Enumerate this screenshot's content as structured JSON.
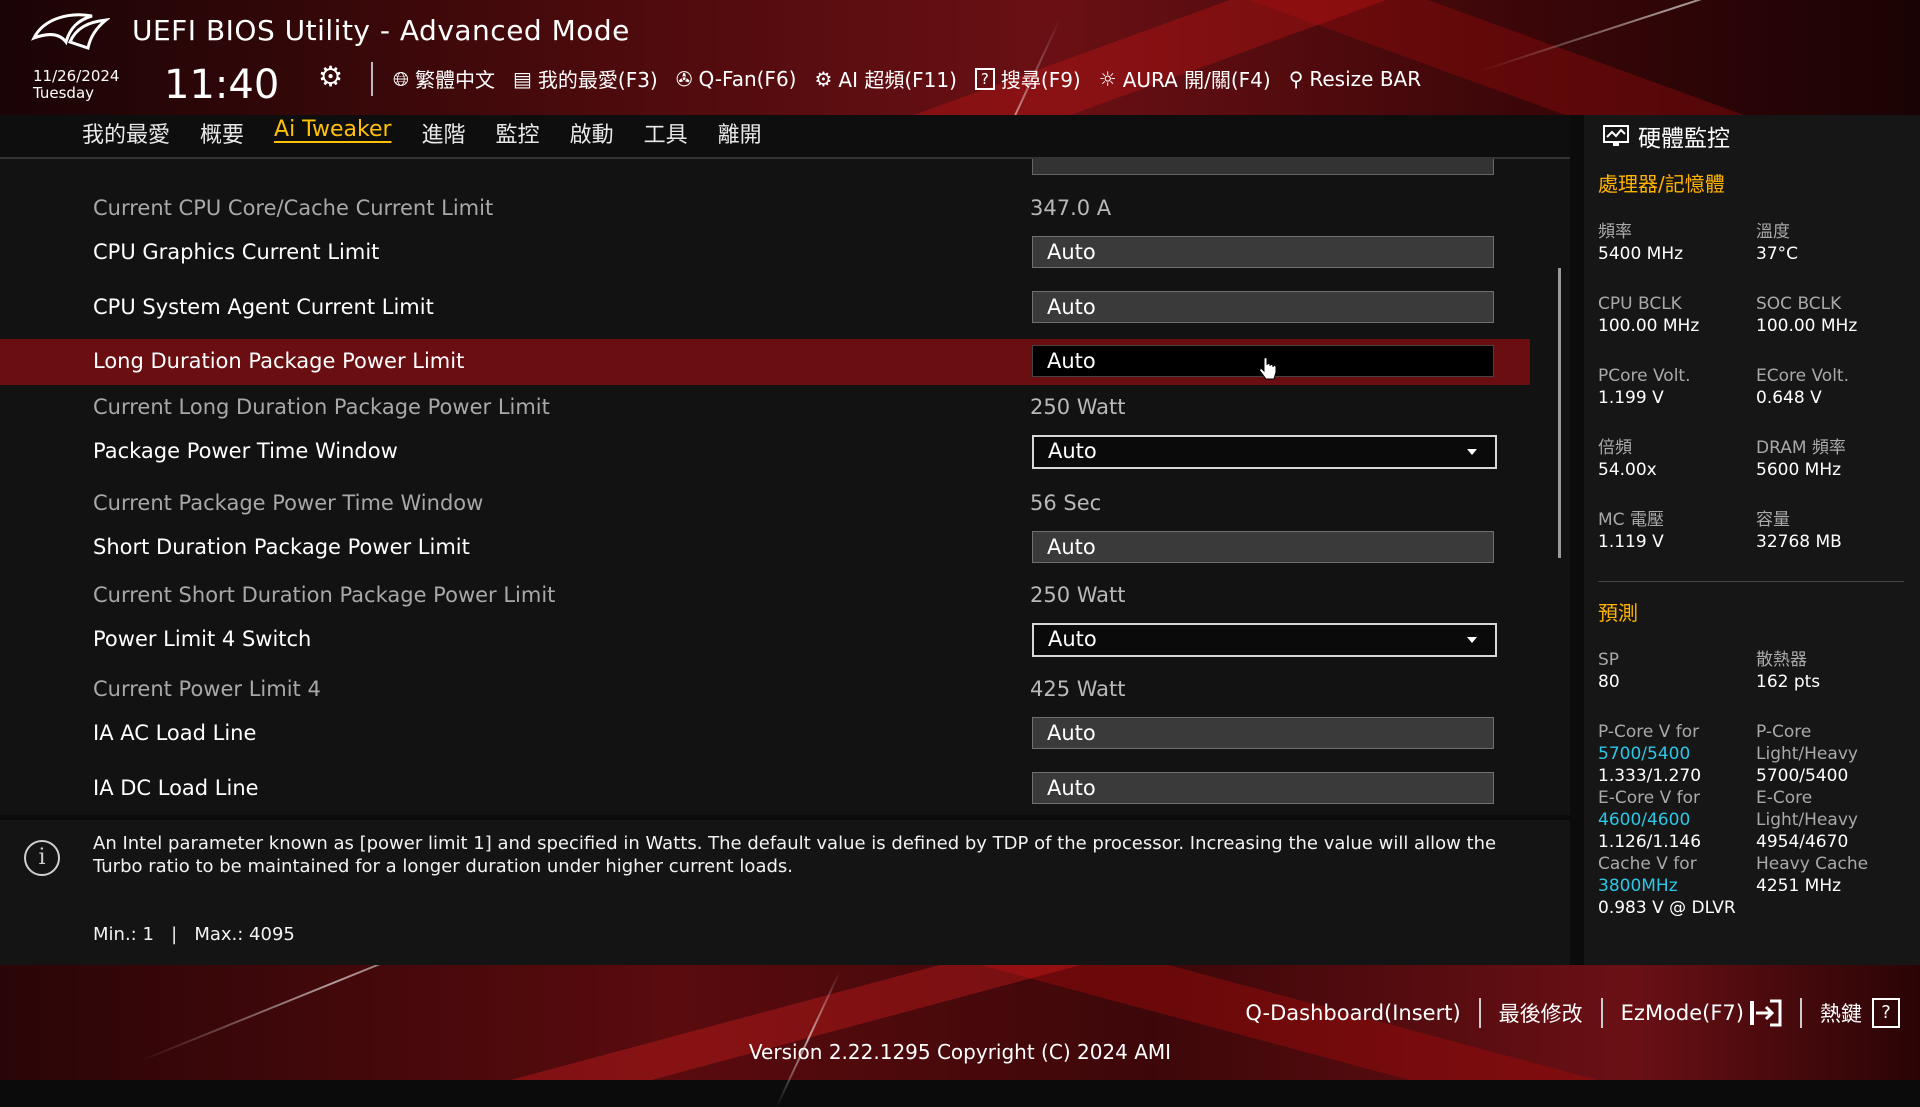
{
  "header": {
    "title": "UEFI BIOS Utility - Advanced Mode",
    "date": "11/26/2024",
    "weekday": "Tuesday",
    "time": "11:40"
  },
  "toolbar": [
    {
      "icon": "globe-icon",
      "label": "繁體中文"
    },
    {
      "icon": "favorites-icon",
      "label": "我的最愛(F3)"
    },
    {
      "icon": "fan-icon",
      "label": "Q-Fan(F6)"
    },
    {
      "icon": "ai-overclock-icon",
      "label": "AI 超頻(F11)"
    },
    {
      "icon": "search-icon",
      "label": "搜尋(F9)"
    },
    {
      "icon": "aura-icon",
      "label": "AURA 開/關(F4)"
    },
    {
      "icon": "resize-bar-icon",
      "label": "Resize BAR"
    }
  ],
  "menu": [
    "我的最愛",
    "概要",
    "Ai Tweaker",
    "進階",
    "監控",
    "啟動",
    "工具",
    "離開"
  ],
  "settings": [
    {
      "label": "Current CPU Core/Cache Current Limit",
      "value": "347.0 A"
    },
    {
      "label": "CPU Graphics Current Limit",
      "value": "Auto"
    },
    {
      "label": "CPU System Agent Current Limit",
      "value": "Auto"
    },
    {
      "label": "Long Duration Package Power Limit",
      "value": "Auto"
    },
    {
      "label": "Current Long Duration Package Power Limit",
      "value": "250 Watt"
    },
    {
      "label": "Package Power Time Window",
      "value": "Auto"
    },
    {
      "label": "Current Package Power Time Window",
      "value": "56 Sec"
    },
    {
      "label": "Short Duration Package Power Limit",
      "value": "Auto"
    },
    {
      "label": "Current Short Duration Package Power Limit",
      "value": "250 Watt"
    },
    {
      "label": "Power Limit 4 Switch",
      "value": "Auto"
    },
    {
      "label": "Current Power Limit 4",
      "value": "425 Watt"
    },
    {
      "label": "IA AC Load Line",
      "value": "Auto"
    },
    {
      "label": "IA DC Load Line",
      "value": "Auto"
    }
  ],
  "help": {
    "text": "An Intel parameter known as [power limit 1] and specified in Watts. The default value is defined by TDP of the processor. Increasing the value will allow the Turbo ratio to be maintained for a longer duration under higher current loads.",
    "min": "Min.: 1",
    "sep": "|",
    "max": "Max.: 4095"
  },
  "monitor": {
    "title": "硬體監控",
    "cpu_section": "處理器/記憶體",
    "cpu": [
      {
        "k": "頻率",
        "v": "5400 MHz"
      },
      {
        "k": "溫度",
        "v": "37°C"
      },
      {
        "k": "CPU BCLK",
        "v": "100.00 MHz"
      },
      {
        "k": "SOC BCLK",
        "v": "100.00 MHz"
      },
      {
        "k": "PCore Volt.",
        "v": "1.199 V"
      },
      {
        "k": "ECore Volt.",
        "v": "0.648 V"
      },
      {
        "k": "倍頻",
        "v": "54.00x"
      },
      {
        "k": "DRAM 頻率",
        "v": "5600 MHz"
      },
      {
        "k": "MC 電壓",
        "v": "1.119 V"
      },
      {
        "k": "容量",
        "v": "32768 MB"
      }
    ],
    "predict_section": "預測",
    "predict": {
      "sp_k": "SP",
      "sp_v": "80",
      "cooler_k": "散熱器",
      "cooler_v": "162 pts",
      "pcore_k": "P-Core V for",
      "pcore_c": "5700/5400",
      "pcore_v": "1.333/1.270",
      "pcore_lh_k1": "P-Core",
      "pcore_lh_k2": "Light/Heavy",
      "pcore_lh_v": "5700/5400",
      "ecore_k": "E-Core V for",
      "ecore_c": "4600/4600",
      "ecore_v": "1.126/1.146",
      "ecore_lh_k1": "E-Core",
      "ecore_lh_k2": "Light/Heavy",
      "ecore_lh_v": "4954/4670",
      "cache_k": "Cache V for",
      "cache_c": "3800MHz",
      "cache_v": "0.983 V @ DLVR",
      "hcache_k": "Heavy Cache",
      "hcache_v": "4251 MHz"
    }
  },
  "footer": {
    "qdash": "Q-Dashboard(Insert)",
    "last_mod": "最後修改",
    "ezmode": "EzMode(F7)",
    "hotkeys": "熱鍵",
    "hotkeys_box": "?",
    "version": "Version 2.22.1295 Copyright (C) 2024 AMI"
  }
}
